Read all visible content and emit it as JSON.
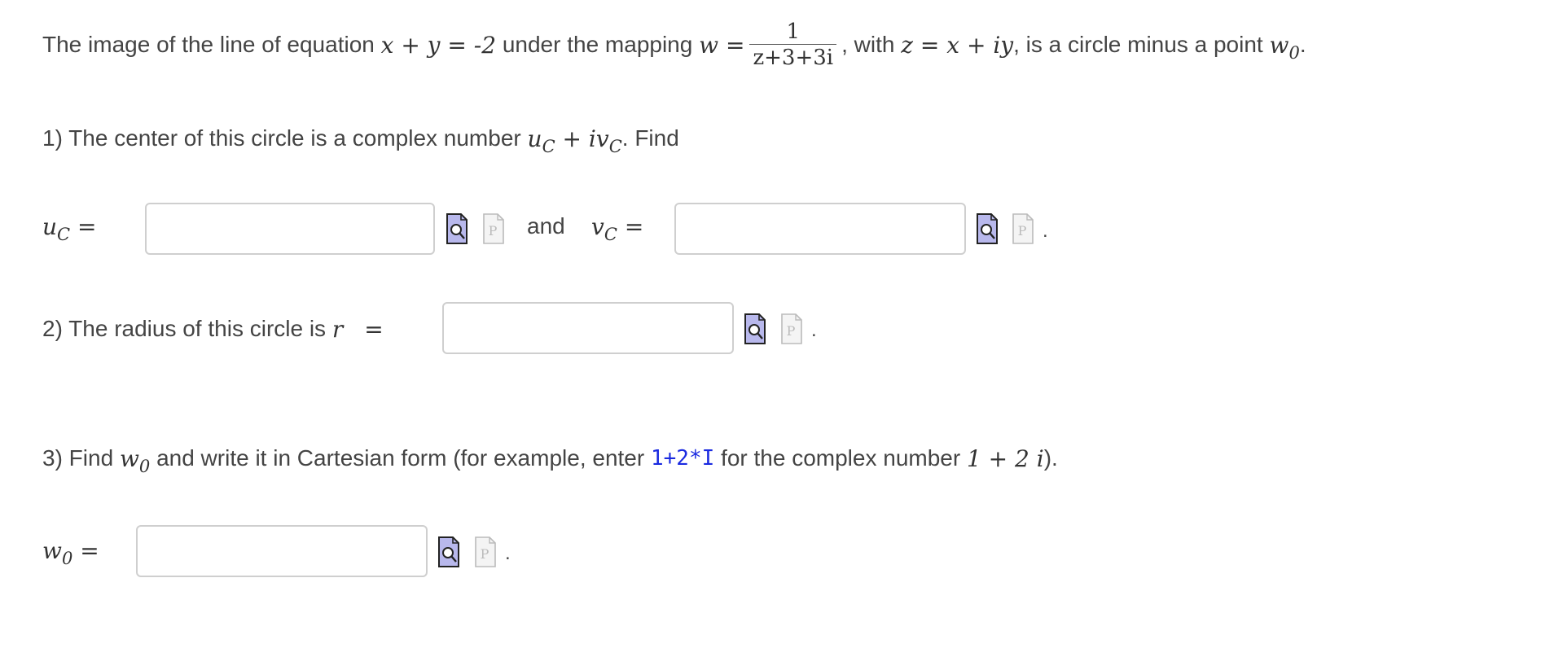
{
  "problem": {
    "intro_a": "The image of the line of equation",
    "intro_eq": "x + y = -2",
    "intro_b": "under the mapping",
    "mapping_lhs": "w =",
    "frac_num": "1",
    "frac_den": "z+3+3i",
    "intro_c": ", with",
    "z_def": "z = x + iy",
    "intro_d": ", is a circle minus a point",
    "w0_symbol": "w",
    "w0_sub": "0",
    "period": "."
  },
  "q1": {
    "text": "1) The center of this circle is a complex number",
    "expr_u": "u",
    "expr_plus": " + iv",
    "sub_c": "C",
    "find": ". Find",
    "uc_label": "u",
    "vc_label": "v",
    "equals": "=",
    "and": "and",
    "uc_value": "",
    "vc_value": ""
  },
  "q2": {
    "text": "2) The radius of this circle is",
    "r_symbol": "r",
    "equals": "=",
    "r_value": ""
  },
  "q3": {
    "text_a": "3) Find",
    "w_symbol": "w",
    "w_sub": "0",
    "text_b": "and write it in Cartesian form (for example, enter",
    "example_code": "1+2*I",
    "text_c": "for the complex number",
    "example_math": "1 + 2 i",
    "text_d": ").",
    "w0_label": "w",
    "w0_sub": "0",
    "equals": "=",
    "w0_value": ""
  },
  "icons": {
    "preview": "preview-icon",
    "problem": "problem-page-icon"
  },
  "colors": {
    "code": "#1a2ae0",
    "input_border": "#cfcfcf",
    "preview_fill": "#b8b8ec"
  }
}
